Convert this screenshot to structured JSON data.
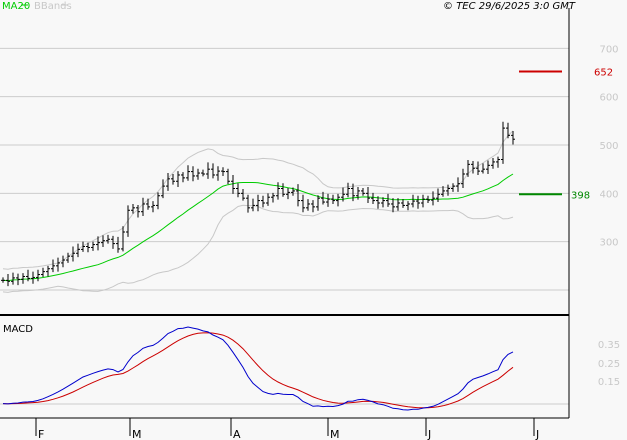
{
  "chart_data": {
    "type": "line",
    "title": "",
    "legend": [
      {
        "name": "MA20",
        "color": "#00cc00"
      },
      {
        "name": "BBands",
        "color": "#c8c8c8"
      }
    ],
    "copyright": "© TEC 29/6/2025 3:0 GMT",
    "price_axis": {
      "ticks": [
        "700",
        "600",
        "500",
        "400",
        "300"
      ],
      "tick_values": [
        700,
        600,
        500,
        400,
        300
      ],
      "ylim": [
        150,
        780
      ]
    },
    "macd_axis": {
      "label": "MACD",
      "ticks": [
        "0.35",
        "0.25",
        "0.15"
      ],
      "tick_values": [
        0.35,
        0.25,
        0.15
      ]
    },
    "x_months": [
      "F",
      "M",
      "A",
      "M",
      "J",
      "J"
    ],
    "levels": [
      {
        "label": "652",
        "value": 652,
        "color": "#cc0000"
      },
      {
        "label": "398",
        "value": 398,
        "color": "#008800"
      }
    ],
    "closes": [
      220,
      218,
      225,
      222,
      228,
      224,
      226,
      232,
      238,
      244,
      250,
      256,
      262,
      270,
      276,
      284,
      290,
      288,
      294,
      298,
      302,
      305,
      296,
      285,
      320,
      365,
      370,
      362,
      378,
      372,
      375,
      395,
      415,
      430,
      425,
      438,
      432,
      445,
      436,
      442,
      440,
      450,
      438,
      446,
      445,
      425,
      410,
      400,
      390,
      370,
      375,
      385,
      380,
      392,
      395,
      410,
      398,
      402,
      405,
      385,
      370,
      378,
      372,
      390,
      382,
      388,
      385,
      392,
      398,
      410,
      395,
      405,
      400,
      390,
      385,
      380,
      385,
      378,
      372,
      380,
      375,
      378,
      384,
      380,
      388,
      386,
      390,
      398,
      405,
      410,
      415,
      420,
      440,
      460,
      452,
      446,
      450,
      458,
      465,
      470,
      535,
      520,
      512
    ],
    "colors": {
      "bars": "#000000",
      "ma20": "#00cc00",
      "bbands": "#c8c8c8",
      "macd": "#0000cc",
      "signal": "#cc0000"
    }
  }
}
